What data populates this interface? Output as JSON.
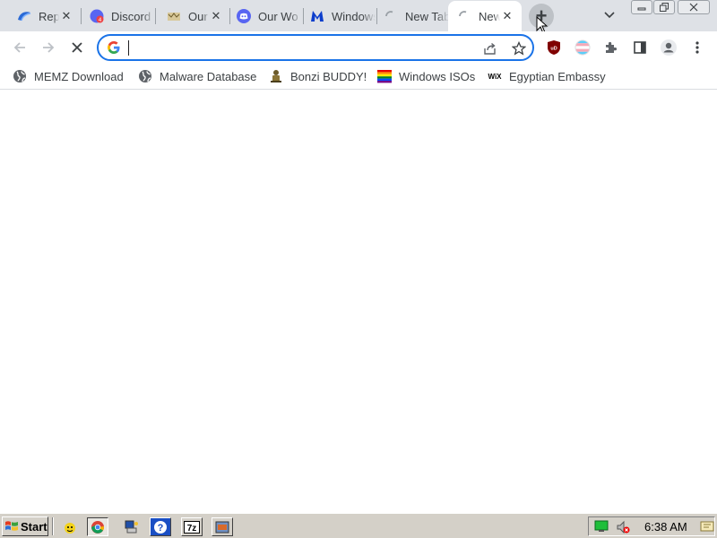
{
  "tabs": [
    {
      "title": "Replit",
      "favicon": "replit-icon"
    },
    {
      "title": "Discord",
      "favicon": "discord-red-icon"
    },
    {
      "title": "Our Wo",
      "favicon": "bonzi-tab-icon"
    },
    {
      "title": "Our Wo",
      "favicon": "discord-icon"
    },
    {
      "title": "Windows",
      "favicon": "malwarebytes-icon"
    },
    {
      "title": "New Tab",
      "favicon": "loading-spinner-icon"
    },
    {
      "title": "New Tab",
      "favicon": "loading-spinner-icon"
    }
  ],
  "omnibox": {
    "value": "",
    "placeholder": ""
  },
  "bookmarks": [
    {
      "label": "MEMZ Download",
      "icon": "globe-icon"
    },
    {
      "label": "Malware Database",
      "icon": "globe-icon"
    },
    {
      "label": "Bonzi BUDDY!",
      "icon": "bonzi-icon"
    },
    {
      "label": "Windows ISOs",
      "icon": "rainbow-flag-icon"
    },
    {
      "label": "Egyptian Embassy",
      "icon": "wix-icon"
    }
  ],
  "taskbar": {
    "start_label": "Start",
    "clock": "6:38 AM",
    "quick_launch": [
      "bonzi-icon",
      "chrome-icon",
      "computer-icon",
      "help-icon",
      "7zip-icon",
      "app-icon"
    ]
  },
  "colors": {
    "accent": "#1a73e8",
    "tabstrip": "#dee1e6",
    "taskbar": "#d4d0c8"
  }
}
